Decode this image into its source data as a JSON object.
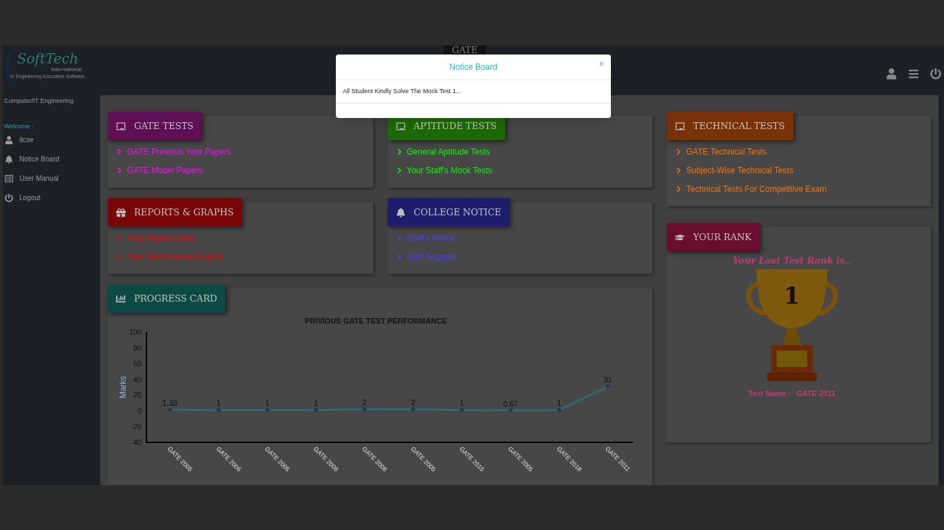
{
  "header": {
    "title": "GATE"
  },
  "sidebar": {
    "logo": {
      "name": "SoftTech",
      "subtitle": "International",
      "tagline": "In Engineering Education Software"
    },
    "department": "Computer/IT Engineering",
    "welcome": "Welcome :",
    "items": [
      {
        "label": "itcse",
        "kind": "user"
      },
      {
        "label": "Notice Board",
        "kind": "bell"
      },
      {
        "label": "User Manual",
        "kind": "manual"
      },
      {
        "label": "Logout",
        "kind": "power"
      }
    ]
  },
  "panels": [
    {
      "title": "GATE TESTS",
      "kind": "tests",
      "color": "#5e0f55",
      "links": [
        "GATE Previous Year Papers",
        "GATE Model Papers"
      ]
    },
    {
      "title": "APTITUDE TESTS",
      "kind": "tests",
      "color": "#1c6a05",
      "links": [
        "General Aptitude Tests",
        "Your Staff's Mock Tests"
      ]
    },
    {
      "title": "REPORTS & GRAPHS",
      "kind": "reports",
      "color": "#780606",
      "links": [
        "Your Report Cards",
        "Your Performance Graphs"
      ]
    },
    {
      "title": "COLLEGE NOTICE",
      "kind": "notice",
      "color": "#1e1c6e",
      "links": [
        "Staff's Notice",
        "Staff Suggest"
      ]
    }
  ],
  "technical": {
    "title": "TECHNICAL TESTS",
    "kind": "tests",
    "color": "#7a3106",
    "links": [
      "GATE Technical Tests",
      "Subject-Wise Technical Tests",
      "Technical Tests For Competitive Exam"
    ]
  },
  "progress": {
    "title": "PROGRESS CARD",
    "color": "#0c4a44",
    "chart_data": {
      "type": "line",
      "title": "PRIVIOUS GATE TEST PERFORMANCE",
      "ylabel": "Marks",
      "categories": [
        "GATE 2005",
        "GATE 2006",
        "GATE 2005",
        "GATE 2006",
        "GATE 2008",
        "GATE 2005",
        "GATE 2015",
        "GATE 2005",
        "GATE 2018",
        "GATE 2011"
      ],
      "series": [
        {
          "color": "#2a6f78",
          "marker": "circle",
          "values": [
            1.33,
            1,
            1,
            1,
            2,
            2,
            1,
            0.67,
            1,
            31
          ]
        }
      ],
      "ylim": [
        -40,
        100
      ],
      "yticks": [
        -40,
        -20,
        0,
        20,
        40,
        60,
        80,
        100
      ],
      "value_labels": [
        "1.33",
        "1",
        "1",
        "1",
        "2",
        "2",
        "1",
        "0.67",
        "1",
        "31"
      ]
    }
  },
  "rank": {
    "title": "YOUR RANK",
    "color": "#6b0d2f",
    "caption": "Your Last Test Rank is..",
    "rank": "1",
    "test_label": "Test Name :",
    "test_name": "GATE 2011"
  },
  "modal": {
    "title": "Notice Board",
    "close": "×",
    "body": "All Student Kindly Solve The Mock Test 1..."
  }
}
